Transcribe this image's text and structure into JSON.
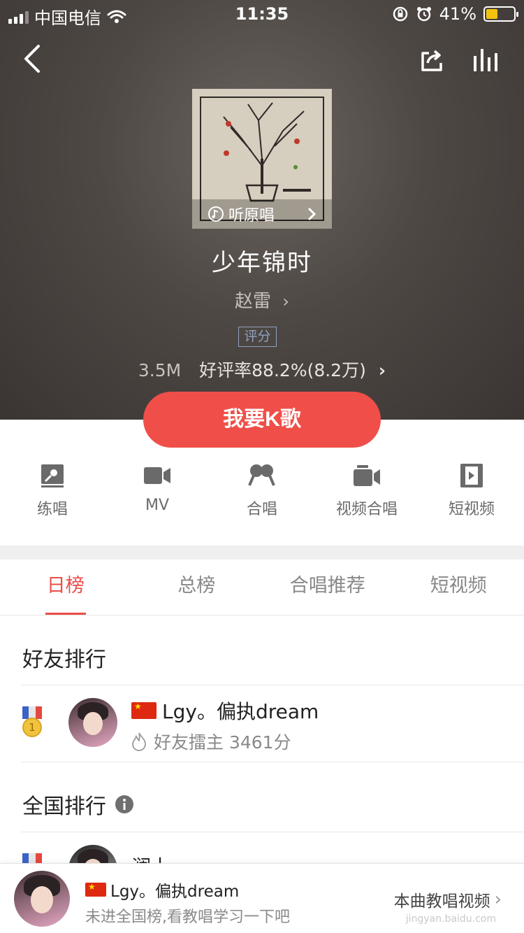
{
  "status_bar": {
    "carrier": "中国电信",
    "time": "11:35",
    "battery": "41%",
    "battery_level": 0.41,
    "icons": [
      "signal-icon",
      "wifi-icon",
      "rotation-lock-icon",
      "alarm-icon",
      "battery-icon"
    ]
  },
  "header": {
    "back_icon": "back-arrow-icon",
    "share_icon": "share-icon",
    "equalizer_icon": "equalizer-icon"
  },
  "song": {
    "cover_overlay_label": "听原唱",
    "title": "少年锦时",
    "artist": "赵雷",
    "rating_badge": "评分",
    "plays": "3.5M",
    "rating_text": "好评率88.2%(8.2万)"
  },
  "primary_button": "我要K歌",
  "actions": [
    {
      "label": "练唱",
      "icon": "practice-icon"
    },
    {
      "label": "MV",
      "icon": "video-camera-icon"
    },
    {
      "label": "合唱",
      "icon": "chorus-icon"
    },
    {
      "label": "视频合唱",
      "icon": "video-chorus-icon"
    },
    {
      "label": "短视频",
      "icon": "short-video-icon"
    }
  ],
  "tabs": [
    {
      "label": "日榜",
      "active": true
    },
    {
      "label": "总榜",
      "active": false
    },
    {
      "label": "合唱推荐",
      "active": false
    },
    {
      "label": "短视频",
      "active": false
    }
  ],
  "friends_ranking": {
    "title": "好友排行",
    "items": [
      {
        "rank": "1",
        "name": "Lgy。偏执dream",
        "subtitle": "好友擂主 3461分"
      }
    ]
  },
  "national_ranking": {
    "title": "全国排行",
    "partial_name": "澜上"
  },
  "bottom_bar": {
    "name": "Lgy。偏执dream",
    "description": "未进全国榜,看教唱学习一下吧",
    "link": "本曲教唱视频"
  },
  "watermark": "jingyan.baidu.com",
  "colors": {
    "accent": "#ef4f48",
    "tab_active": "#ea4d48",
    "rating_badge": "#8fa0c0",
    "hero_background": "#4e4844"
  }
}
